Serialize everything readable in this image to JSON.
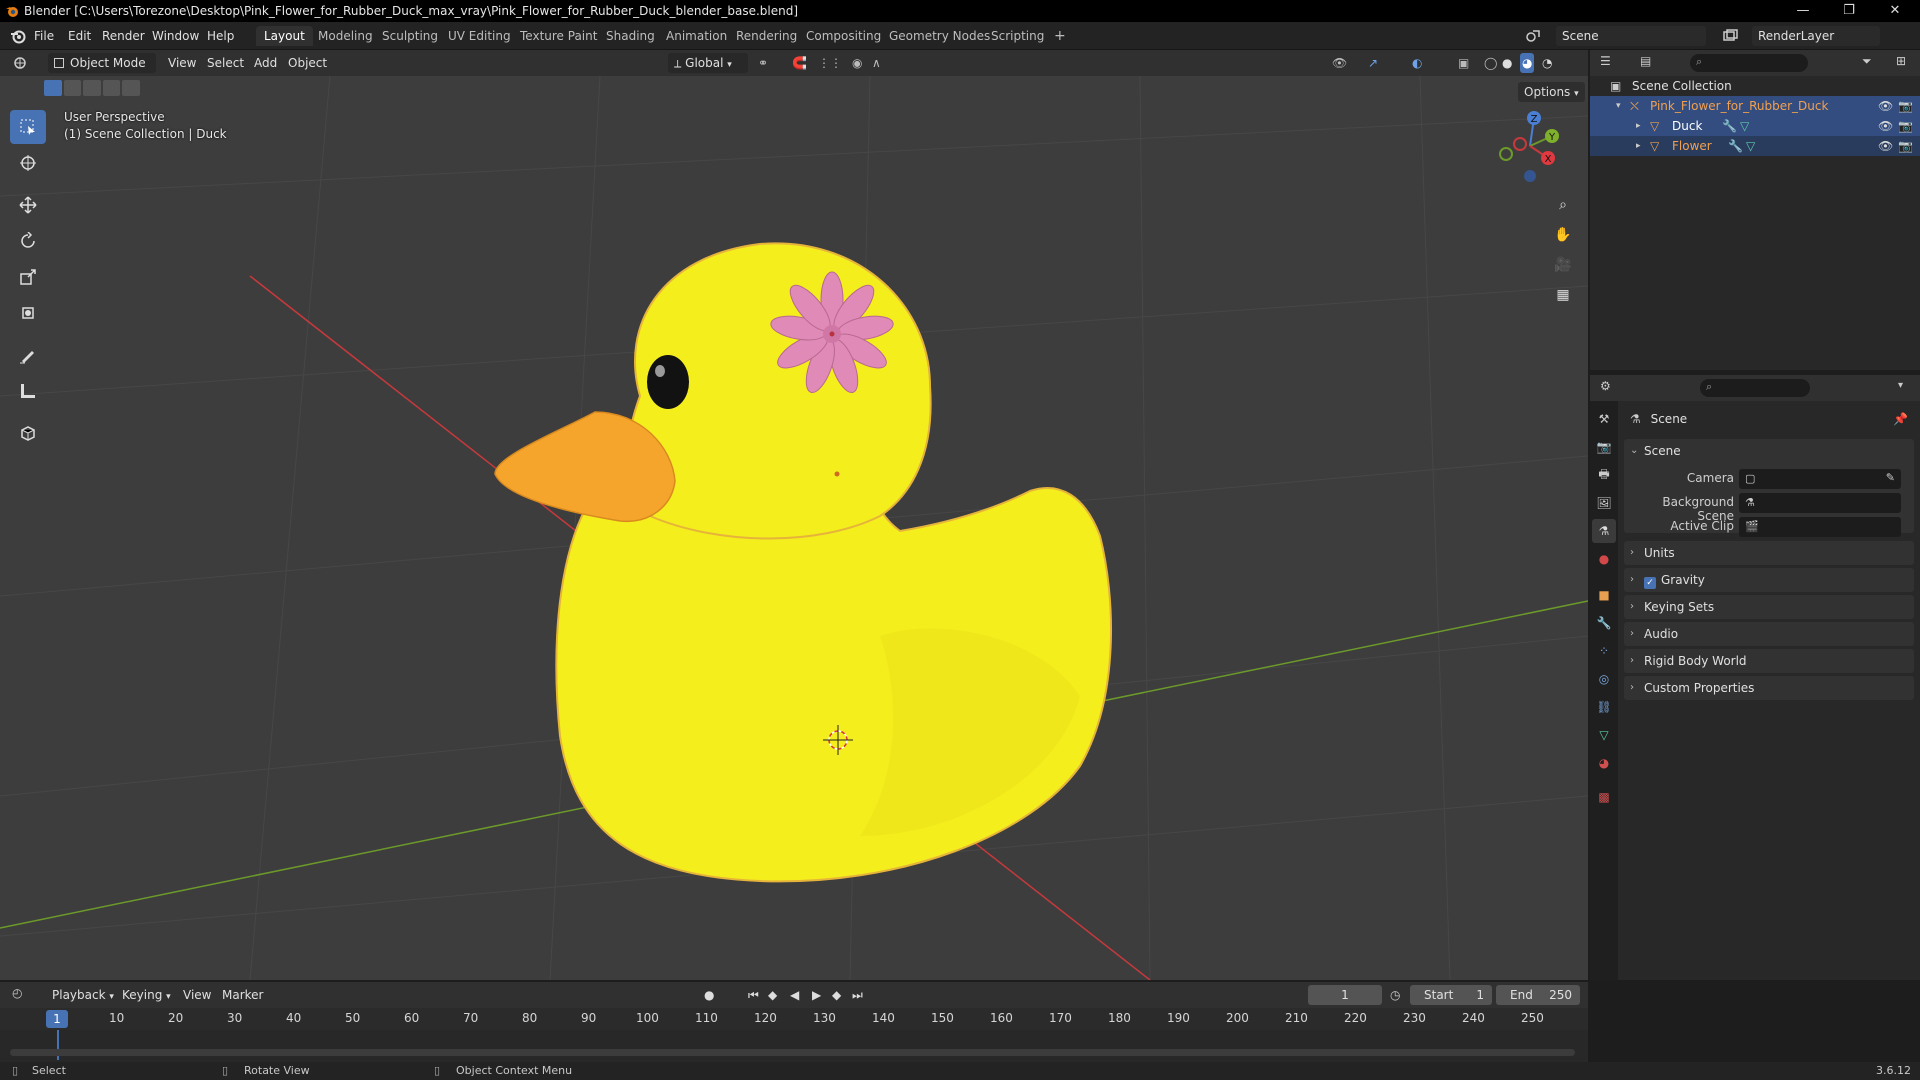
{
  "window": {
    "title": "Blender [C:\\Users\\Torezone\\Desktop\\Pink_Flower_for_Rubber_Duck_max_vray\\Pink_Flower_for_Rubber_Duck_blender_base.blend]",
    "minimize": "—",
    "restore": "❐",
    "close": "✕"
  },
  "menu": {
    "items": [
      "File",
      "Edit",
      "Render",
      "Window",
      "Help"
    ]
  },
  "workspaces": [
    "Layout",
    "Modeling",
    "Sculpting",
    "UV Editing",
    "Texture Paint",
    "Shading",
    "Animation",
    "Rendering",
    "Compositing",
    "Geometry Nodes",
    "Scripting"
  ],
  "workspace_add": "+",
  "scene_selector": {
    "value": "Scene"
  },
  "view_layer": {
    "value": "RenderLayer"
  },
  "viewport_header": {
    "mode": "Object Mode",
    "view": "View",
    "select": "Select",
    "add": "Add",
    "object": "Object",
    "transform_orientation": "Global",
    "options": "Options"
  },
  "viewport": {
    "perspective_label": "User Perspective",
    "collection_label": "(1) Scene Collection | Duck",
    "gizmo_axes": {
      "x": "X",
      "y": "Y",
      "z": "Z"
    },
    "colors": {
      "duck_body": "#f4ee1c",
      "beak": "#f5a52c",
      "flower": "#e08ab8",
      "axis_x": "#c7393c",
      "axis_y": "#6c9a2a",
      "grid": "#4a4a4a",
      "background": "#3d3d3d"
    }
  },
  "outliner": {
    "root": "Scene Collection",
    "rows": [
      {
        "name": "Pink_Flower_for_Rubber_Duck",
        "type": "empty"
      },
      {
        "name": "Duck",
        "type": "mesh"
      },
      {
        "name": "Flower",
        "type": "mesh"
      }
    ]
  },
  "properties": {
    "breadcrumb": "Scene",
    "scene_panel": {
      "title": "Scene",
      "camera_label": "Camera",
      "background_scene_label": "Background Scene",
      "active_clip_label": "Active Clip"
    },
    "collapsed_panels": [
      "Units",
      "Gravity",
      "Keying Sets",
      "Audio",
      "Rigid Body World",
      "Custom Properties"
    ],
    "gravity_checked": true
  },
  "timeline": {
    "playback": "Playback",
    "keying": "Keying",
    "view": "View",
    "marker": "Marker",
    "current_frame": "1",
    "start_label": "Start",
    "start_value": "1",
    "end_label": "End",
    "end_value": "250",
    "ruler_current": "1",
    "ruler_ticks": [
      "10",
      "20",
      "30",
      "40",
      "50",
      "60",
      "70",
      "80",
      "90",
      "100",
      "110",
      "120",
      "130",
      "140",
      "150",
      "160",
      "170",
      "180",
      "190",
      "200",
      "210",
      "220",
      "230",
      "240",
      "250"
    ]
  },
  "statusbar": {
    "select": "Select",
    "rotate_view": "Rotate View",
    "context_menu": "Object Context Menu",
    "version": "3.6.12"
  }
}
